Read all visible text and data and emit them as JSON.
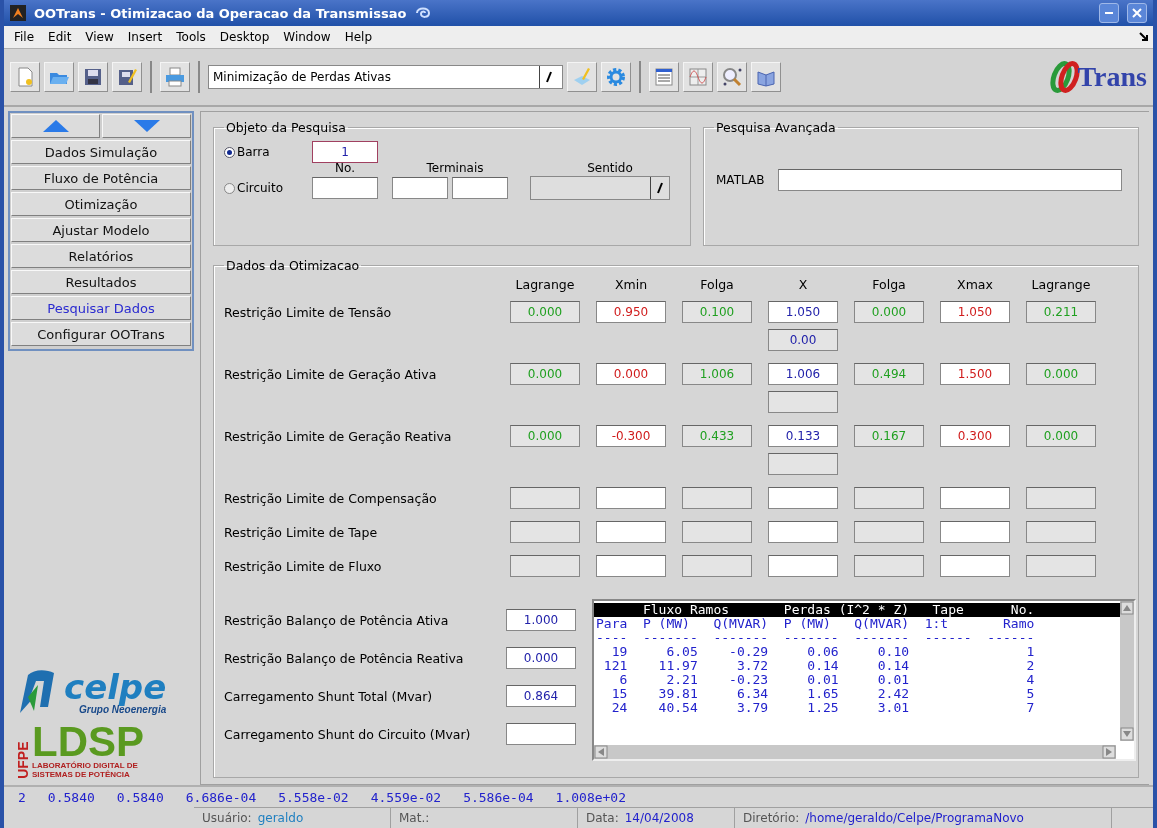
{
  "window": {
    "title": "OOTrans - Otimizacao da Operacao da Transmissao"
  },
  "menu": [
    "File",
    "Edit",
    "View",
    "Insert",
    "Tools",
    "Desktop",
    "Window",
    "Help"
  ],
  "toolbar": {
    "problem": "Minimização de Perdas Ativas",
    "logo": "Trans"
  },
  "sidebar": {
    "items": [
      {
        "label": "Dados Simulação",
        "selected": false
      },
      {
        "label": "Fluxo de Potência",
        "selected": false
      },
      {
        "label": "Otimização",
        "selected": false
      },
      {
        "label": "Ajustar Modelo",
        "selected": false
      },
      {
        "label": "Relatórios",
        "selected": false
      },
      {
        "label": "Resultados",
        "selected": false
      },
      {
        "label": "Pesquisar Dados",
        "selected": true
      },
      {
        "label": "Configurar OOTrans",
        "selected": false
      }
    ]
  },
  "logos": {
    "celpe": "celpe",
    "celpe_group": "Grupo Neoenergia",
    "ufpe": "UFPE",
    "ldsp": "LDSP",
    "ldsp_caption": [
      "LABORATÓRIO DIGITAL DE",
      "SISTEMAS DE POTÊNCIA"
    ]
  },
  "search_object": {
    "title": "Objeto da Pesquisa",
    "options": [
      {
        "label": "Barra",
        "selected": true
      },
      {
        "label": "Circuito",
        "selected": false
      }
    ],
    "bus_value": "1",
    "circuit_headers": [
      "No.",
      "Terminais",
      "Sentido"
    ]
  },
  "advanced_search": {
    "title": "Pesquisa Avançada",
    "label": "MATLAB"
  },
  "optimization": {
    "title": "Dados da Otimizacao",
    "columns": [
      {
        "label": "Lagrange",
        "kind": "multiplier"
      },
      {
        "label": "Xmin",
        "kind": "bound"
      },
      {
        "label": "Folga",
        "kind": "slack"
      },
      {
        "label": "X",
        "kind": "state"
      },
      {
        "label": "Folga",
        "kind": "slack"
      },
      {
        "label": "Xmax",
        "kind": "bound"
      },
      {
        "label": "Lagrange",
        "kind": "multiplier"
      }
    ],
    "rows": [
      {
        "label": "Restrição Limite de Tensão",
        "values": [
          "0.000",
          "0.950",
          "0.100",
          "1.050",
          "0.000",
          "1.050",
          "0.211"
        ],
        "sub_field": {
          "shown": true,
          "value": "0.00"
        }
      },
      {
        "label": "Restrição Limite de Geração Ativa",
        "values": [
          "0.000",
          "0.000",
          "1.006",
          "1.006",
          "0.494",
          "1.500",
          "0.000"
        ],
        "sub_field": {
          "shown": true
        }
      },
      {
        "label": "Restrição Limite de Geração Reativa",
        "values": [
          "0.000",
          "-0.300",
          "0.433",
          "0.133",
          "0.167",
          "0.300",
          "0.000"
        ],
        "sub_field": {
          "shown": true
        }
      },
      {
        "label": "Restrição Limite de Compensação"
      },
      {
        "label": "Restrição Limite de Tape"
      },
      {
        "label": "Restrição Limite de Fluxo"
      }
    ],
    "balance": [
      {
        "label": "Restrição Balanço de Potência Ativa",
        "value": "1.000"
      },
      {
        "label": "Restrição Balanço de Potência Reativa",
        "value": "0.000"
      },
      {
        "label": "Carregamento Shunt Total (Mvar)",
        "value": "0.864"
      },
      {
        "label": "Carregamento Shunt do Circuito (Mvar)"
      }
    ],
    "listing": [
      {
        "text": "      Fluxo Ramos       Perdas (I^2 * Z)   Tape      No.",
        "selected": true
      },
      {
        "text": "Para  P (MW)   Q(MVAR)  P (MW)   Q(MVAR)  1:t       Ramo",
        "selected": false
      },
      {
        "text": "----  -------  -------  -------  -------  ------  ------",
        "selected": false
      },
      {
        "text": "  19     6.05    -0.29     0.06     0.10               1",
        "selected": false
      },
      {
        "text": " 121    11.97     3.72     0.14     0.14               2",
        "selected": false
      },
      {
        "text": "   6     2.21    -0.23     0.01     0.01               4",
        "selected": false
      },
      {
        "text": "  15    39.81     6.34     1.65     2.42               5",
        "selected": false
      },
      {
        "text": "  24    40.54     3.79     1.25     3.01               7",
        "selected": false
      }
    ]
  },
  "status_values": [
    "2",
    "0.5840",
    "0.5840",
    "6.686e-04",
    "5.558e-02",
    "4.559e-02",
    "5.586e-04",
    "1.008e+02"
  ],
  "footer": {
    "user_label": "Usuário:",
    "user": "geraldo",
    "mat_label": "Mat.:",
    "date_label": "Data:",
    "date": "14/04/2008",
    "dir_label": "Diretório:",
    "dir": "/home/geraldo/Celpe/ProgramaNovo"
  }
}
